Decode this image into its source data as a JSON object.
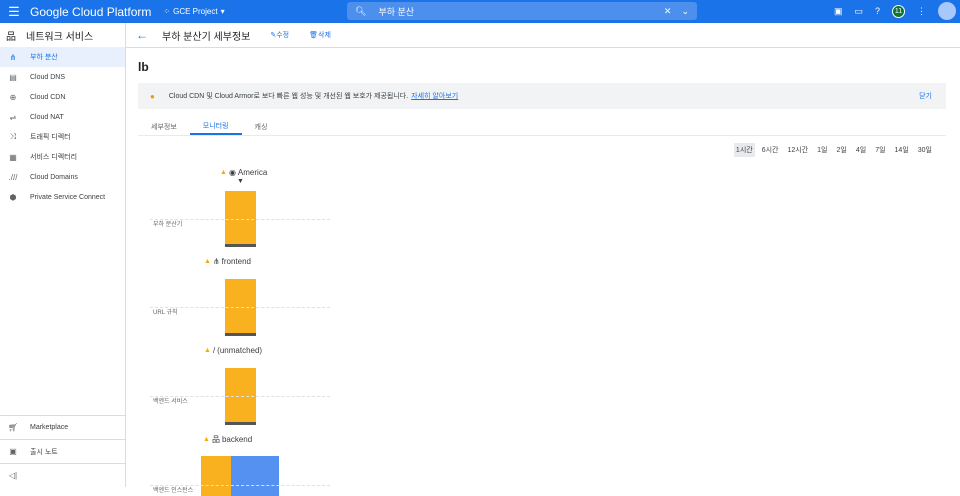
{
  "topbar": {
    "brand": "Google Cloud Platform",
    "project": "GCE Project",
    "search_value": "부하 분산",
    "notification_count": "11"
  },
  "sidebar": {
    "title": "네트워크 서비스",
    "items": [
      {
        "label": "부하 분산",
        "icon": "load-balancing-icon"
      },
      {
        "label": "Cloud DNS",
        "icon": "dns-icon"
      },
      {
        "label": "Cloud CDN",
        "icon": "cdn-icon"
      },
      {
        "label": "Cloud NAT",
        "icon": "nat-icon"
      },
      {
        "label": "트래픽 디렉터",
        "icon": "traffic-director-icon"
      },
      {
        "label": "서비스 디렉터리",
        "icon": "service-directory-icon"
      },
      {
        "label": "Cloud Domains",
        "icon": "domains-icon"
      },
      {
        "label": "Private Service Connect",
        "icon": "shield-icon"
      }
    ],
    "bottom": {
      "marketplace": "Marketplace",
      "release_notes": "출시 노트",
      "collapse": "◁|"
    }
  },
  "subheader": {
    "title": "부하 분산기 세부정보",
    "edit": "수정",
    "delete": "삭제"
  },
  "main": {
    "name": "lb",
    "banner": {
      "text": "Cloud CDN 및 Cloud Armor로 보다 빠른 웹 성능 및 개선된 웹 보호가 제공됩니다.",
      "link": "자세히 알아보기",
      "close": "닫기"
    },
    "tabs": [
      "세부정보",
      "모니터링",
      "캐싱"
    ],
    "ranges": [
      "1시간",
      "6시간",
      "12시간",
      "1일",
      "2일",
      "4일",
      "7일",
      "14일",
      "30일"
    ],
    "flow": {
      "nodes": [
        "America",
        "frontend",
        "(unmatched)",
        "backend"
      ],
      "rows": [
        "부하 분산기",
        "URL 규칙",
        "백엔드 서비스",
        "백엔드 인스턴스"
      ]
    }
  },
  "colors": {
    "accent": "#1a73e8",
    "bar": "#f9b11f",
    "bar2": "#5591f0"
  }
}
